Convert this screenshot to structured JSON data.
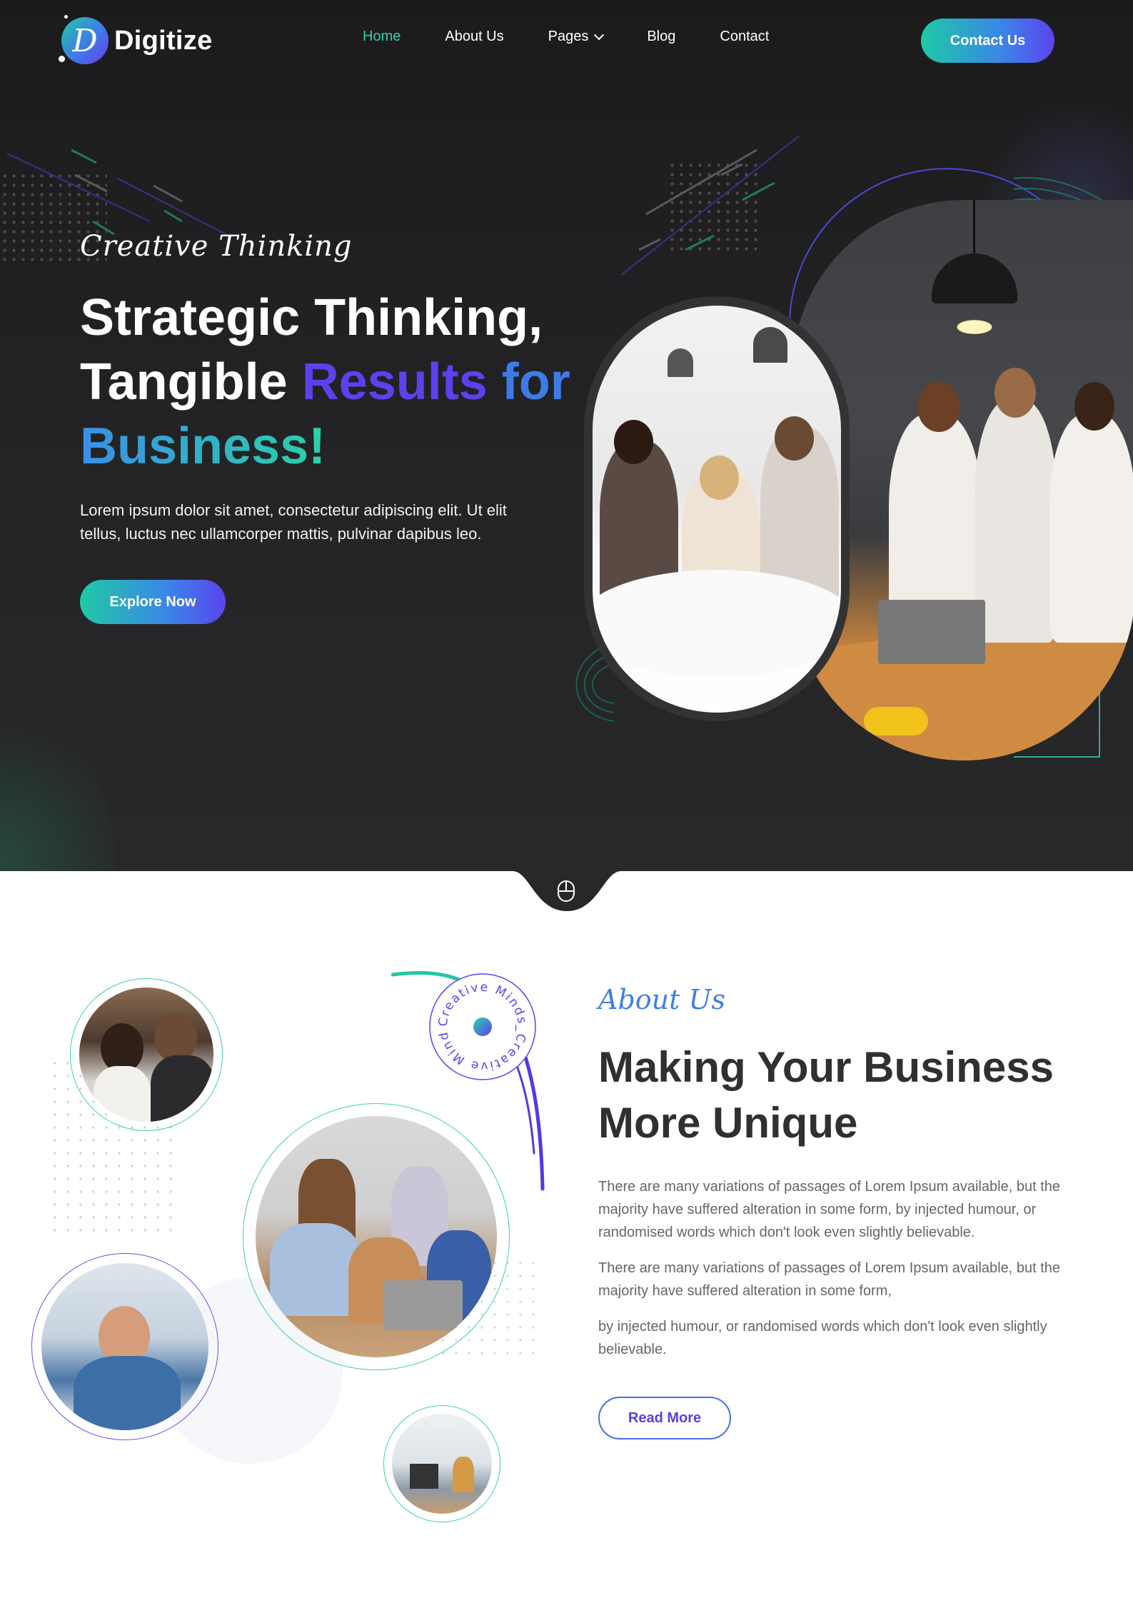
{
  "brand": {
    "name": "Digitize",
    "logo_letter": "D"
  },
  "nav": {
    "items": [
      {
        "label": "Home",
        "active": true
      },
      {
        "label": "About Us",
        "active": false
      },
      {
        "label": "Pages",
        "active": false,
        "has_dropdown": true
      },
      {
        "label": "Blog",
        "active": false
      },
      {
        "label": "Contact",
        "active": false
      }
    ],
    "cta_label": "Contact Us"
  },
  "hero": {
    "subtitle": "Creative Thinking",
    "title_line1": "Strategic Thinking,",
    "title_line2_a": "Tangible ",
    "title_line2_b": "Results ",
    "title_line2_c": "for",
    "title_line3": "Business!",
    "description": "Lorem ipsum dolor sit amet, consectetur adipiscing elit. Ut elit tellus, luctus nec ullamcorper mattis, pulvinar dapibus leo.",
    "button_label": "Explore Now"
  },
  "about": {
    "subtitle": "About Us",
    "title": "Making Your Business More Unique",
    "paragraph1": "There are many variations of passages of Lorem Ipsum available, but the majority have suffered alteration in some form, by injected humour, or randomised words which don't look even slightly believable.",
    "paragraph2": "There are many variations of passages of Lorem Ipsum available, but the majority have suffered alteration in some form,",
    "paragraph3": "by injected humour, or randomised words which don't look even slightly believable.",
    "button_label": "Read More",
    "badge_text": "Creative Minds_Creative Minds_"
  },
  "colors": {
    "hero_bg": "#1e1e20",
    "accent_teal": "#2ed3a6",
    "accent_blue": "#3f7be8",
    "accent_purple": "#5b42ee",
    "heading_dark": "#303030",
    "body_gray": "#666666"
  },
  "icons": {
    "scroll": "mouse-icon",
    "dropdown": "chevron-down-icon"
  }
}
